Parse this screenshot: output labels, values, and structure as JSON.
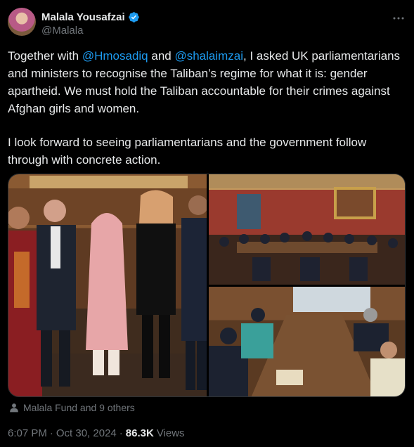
{
  "author": {
    "display_name": "Malala Yousafzai",
    "handle": "@Malala",
    "verified": true,
    "avatar_icon": "avatar"
  },
  "tweet": {
    "p1_pre": "Together with ",
    "mention1": "@Hmosadiq",
    "p1_mid": " and ",
    "mention2": "@shalaimzai",
    "p1_post": ", I asked UK parliamentarians and ministers to recognise the Taliban’s regime for what it is: gender apartheid. We must hold the Taliban accountable for their crimes against Afghan girls and women.",
    "p2": "I look forward to seeing parliamentarians and the government follow through with concrete action."
  },
  "tagged": {
    "text": "Malala Fund and 9 others",
    "icon": "person-icon"
  },
  "meta": {
    "time": "6:07 PM",
    "date": "Oct 30, 2024",
    "views_count": "86.3K",
    "views_label": "Views",
    "separator": "·"
  },
  "colors": {
    "background": "#000000",
    "text": "#e7e9ea",
    "secondary": "#71767b",
    "link": "#1d9bf0",
    "verified": "#1d9bf0"
  }
}
